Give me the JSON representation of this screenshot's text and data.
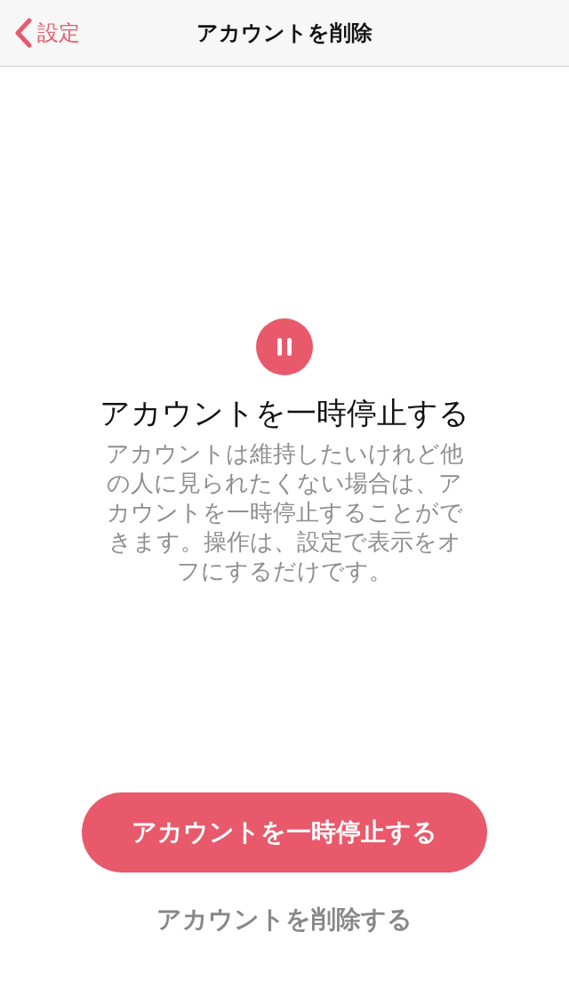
{
  "nav_bar": {
    "back_label": "設定",
    "title": "アカウントを削除"
  },
  "pause_section": {
    "heading": "アカウントを一時停止する",
    "description": "アカウントは維持したいけれど他の人に見られたくない場合は、アカウントを一時停止することができます。操作は、設定で表示をオフにするだけです。"
  },
  "primary_button": "アカウントを一時停止する",
  "delete_link": "アカウントを削除する"
}
